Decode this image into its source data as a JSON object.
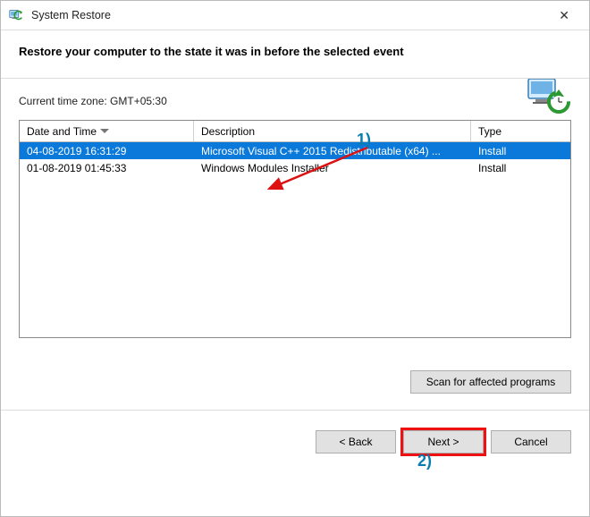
{
  "title": "System Restore",
  "subtitle": "Restore your computer to the state it was in before the selected event",
  "timezone_label": "Current time zone: GMT+05:30",
  "columns": {
    "date": "Date and Time",
    "desc": "Description",
    "type": "Type"
  },
  "rows": [
    {
      "date": "04-08-2019 16:31:29",
      "desc": "Microsoft Visual C++ 2015 Redistributable (x64) ...",
      "type": "Install",
      "selected": true
    },
    {
      "date": "01-08-2019 01:45:33",
      "desc": "Windows Modules Installer",
      "type": "Install",
      "selected": false
    }
  ],
  "scan_label": "Scan for affected programs",
  "buttons": {
    "back": "< Back",
    "next": "Next >",
    "cancel": "Cancel"
  },
  "annotations": {
    "a1": "1)",
    "a2": "2)"
  }
}
